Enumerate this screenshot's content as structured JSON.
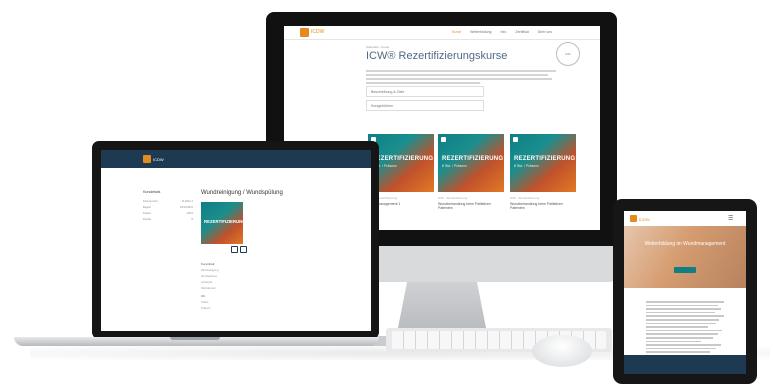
{
  "imac": {
    "logo_text": "ICDW",
    "nav": [
      "Kurse",
      "Weiterbildung",
      "Info",
      "Zertifikat",
      "Über uns"
    ],
    "breadcrumb": "Startseite › Kurse",
    "title": "ICW® Rezertifizierungskurse",
    "badge": "Info",
    "accordion": [
      "Beschreibung & Ziele",
      "Kursgebühren"
    ],
    "courses": [
      {
        "heading": "REZERTIFIZIERUNG",
        "sub": "8 Std. / Präsenz",
        "meta": "ICW · Rezertifizierung",
        "title": "Wundmanagement 1"
      },
      {
        "heading": "REZERTIFIZIERUNG",
        "sub": "8 Std. / Präsenz",
        "meta": "ICW · Rezertifizierung",
        "title": "Wundbehandlung beim Palliativen Patienten"
      },
      {
        "heading": "REZERTIFIZIERUNG",
        "sub": "8 Std. / Präsenz",
        "meta": "ICW · Rezertifizierung",
        "title": "Wundbehandlung beim Palliativen Patienten"
      }
    ]
  },
  "macbook": {
    "logo_text": "ICDW",
    "page_title": "Wundreinigung / Wundspülung",
    "image_heading": "REZERTIFIZIERUNG",
    "sidebar": {
      "heading": "Kursdetails",
      "rows": [
        {
          "label": "Kursnummer",
          "value": "R-2021-1"
        },
        {
          "label": "Beginn",
          "value": "18.09.2021"
        },
        {
          "label": "Kosten",
          "value": "120 €"
        },
        {
          "label": "Punkte",
          "value": "8"
        }
      ]
    },
    "sections": [
      {
        "heading": "Kursinhalt",
        "items": [
          "Wundreinigung",
          "Wundspülung",
          "Antiseptik",
          "Débridement"
        ]
      },
      {
        "heading": "Ort",
        "items": [
          "Online",
          "Präsenz"
        ]
      }
    ]
  },
  "ipad": {
    "logo_text": "ICDW",
    "hero_text": "Weiterbildung im Wundmanagement"
  },
  "colors": {
    "accent": "#e58a1f",
    "brand": "#1e3a52",
    "teal": "#0f7e85"
  }
}
